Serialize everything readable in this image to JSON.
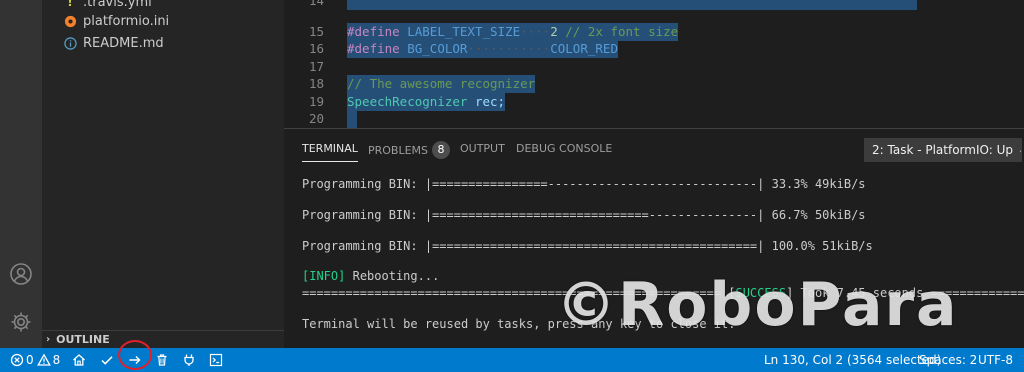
{
  "sidebar": {
    "files": [
      {
        "name": ".travis.yml",
        "icon": "exclamation-icon"
      },
      {
        "name": "platformio.ini",
        "icon": "platformio-icon"
      },
      {
        "name": "README.md",
        "icon": "info-icon"
      }
    ],
    "outline_label": "OUTLINE"
  },
  "editor": {
    "lines": [
      {
        "num": "14"
      },
      {
        "num": "15",
        "kw": "#define",
        "name": "LABEL_TEXT_SIZE",
        "dots": "····",
        "value": "2",
        "comment": "// 2x font size"
      },
      {
        "num": "16",
        "kw": "#define",
        "name": "BG_COLOR",
        "dots": "···········",
        "value": "COLOR_RED"
      },
      {
        "num": "17"
      },
      {
        "num": "18",
        "comment": "// The awesome recognizer"
      },
      {
        "num": "19",
        "type": "SpeechRecognizer",
        "var": "rec;"
      },
      {
        "num": "20"
      }
    ]
  },
  "panel": {
    "tabs": [
      {
        "label": "TERMINAL",
        "active": true
      },
      {
        "label": "PROBLEMS",
        "badge": "8"
      },
      {
        "label": "OUTPUT"
      },
      {
        "label": "DEBUG CONSOLE"
      }
    ],
    "task_select": "2: Task - PlatformIO: Up",
    "terminal_lines": [
      "Programming BIN: |================-----------------------------| 33.3% 49kiB/s",
      "Programming BIN: |==============================---------------| 66.7% 50kiB/s",
      "Programming BIN: |=============================================| 100.0% 51kiB/s",
      "Rebooting...",
      "Terminal will be reused by tasks, press any key to close it."
    ],
    "info_tag": "[INFO]",
    "success_prefix": "==========================================================",
    "success_tag": "SUCCESS",
    "success_text": "Took 7.45 seconds",
    "success_suffix": "================================"
  },
  "status": {
    "errors": "0",
    "warnings": "8",
    "position": "Ln 130, Col 2 (3564 selected)",
    "spaces": "Spaces: 2",
    "encoding": "UTF-8"
  },
  "watermark": "©RoboPara",
  "colors": {
    "status_bar": "#007acc",
    "activity_bar": "#333333",
    "sidebar": "#252526",
    "editor": "#1e1e1e",
    "selection": "#264f78",
    "highlight_circle": "#e0202a"
  }
}
